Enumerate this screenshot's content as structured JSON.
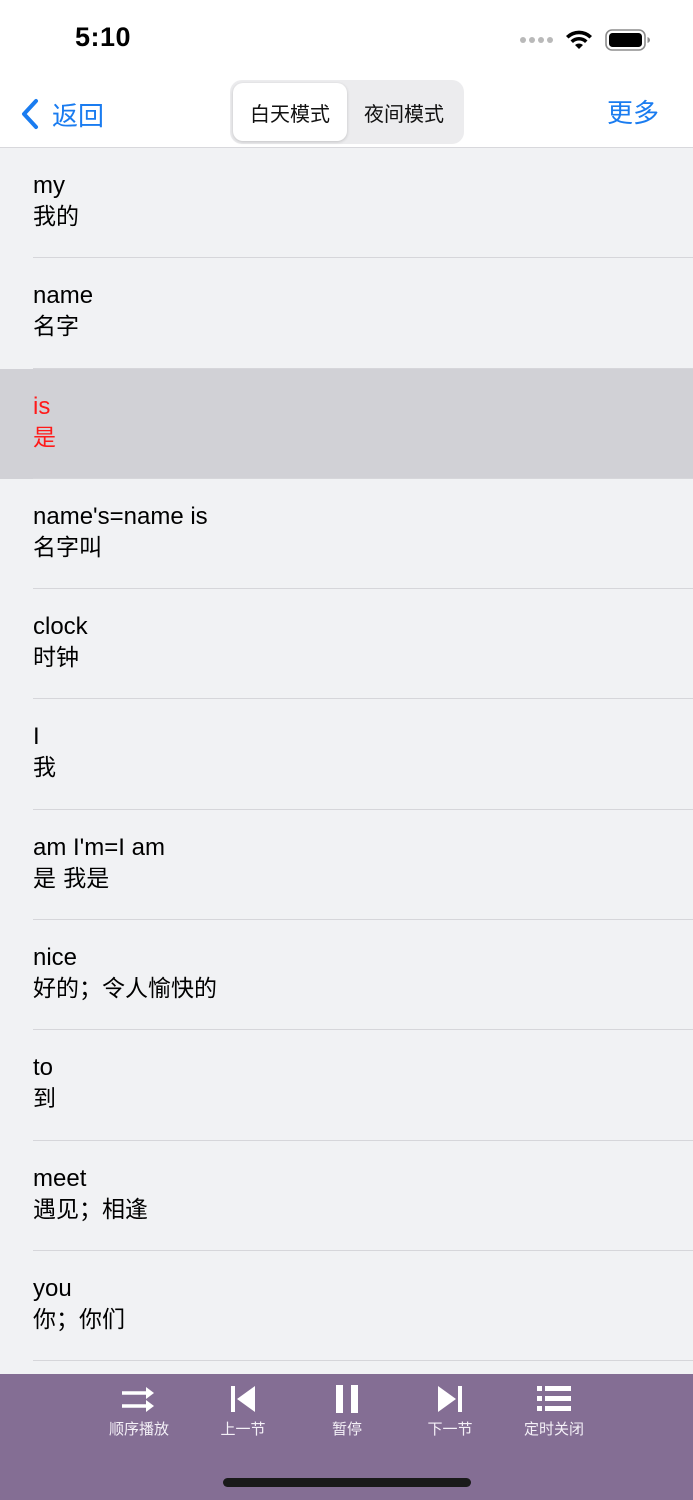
{
  "status": {
    "time": "5:10"
  },
  "nav": {
    "back_label": "返回",
    "modes": [
      "白天模式",
      "夜间模式"
    ],
    "active_mode": 0,
    "more_label": "更多"
  },
  "words": [
    {
      "en": "my",
      "zh": "我的"
    },
    {
      "en": "name",
      "zh": "名字"
    },
    {
      "en": "is",
      "zh": "是"
    },
    {
      "en": "name's=name is",
      "zh": "名字叫"
    },
    {
      "en": "clock",
      "zh": "时钟"
    },
    {
      "en": "I",
      "zh": "我"
    },
    {
      "en": "am I'm=I am",
      "zh": "是 我是"
    },
    {
      "en": "nice",
      "zh": "好的；令人愉快的"
    },
    {
      "en": "to",
      "zh": "到"
    },
    {
      "en": "meet",
      "zh": "遇见；相逢"
    },
    {
      "en": "you",
      "zh": "你；你们"
    }
  ],
  "highlight_index": 2,
  "controls": {
    "order_play": "顺序播放",
    "prev": "上一节",
    "pause": "暂停",
    "next": "下一节",
    "timer_off": "定时关闭"
  },
  "colors": {
    "accent": "#1a7cf0",
    "highlight_text": "#ff1a1a",
    "bottom_bar": "#846e94"
  }
}
